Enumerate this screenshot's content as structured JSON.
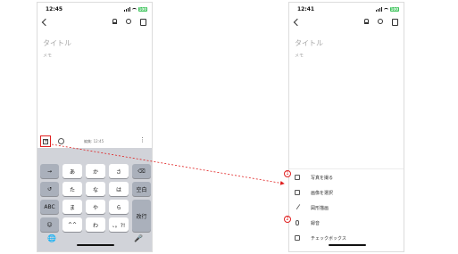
{
  "left_phone": {
    "status_time": "12:45",
    "battery": "100",
    "title_placeholder": "タイトル",
    "memo_placeholder": "メモ",
    "edited_text": "編集: 12:45",
    "keyboard": {
      "row1": [
        "→",
        "あ",
        "か",
        "さ",
        "⌫"
      ],
      "row2": [
        "↺",
        "た",
        "な",
        "は",
        "空白"
      ],
      "row3": [
        "ABC",
        "ま",
        "や",
        "ら",
        "改行"
      ],
      "row4": [
        "☺",
        "^^",
        "わ",
        "、。?!"
      ],
      "globe": "🌐",
      "mic": "🎤"
    }
  },
  "right_phone": {
    "status_time": "12:41",
    "battery": "100",
    "title_placeholder": "タイトル",
    "memo_placeholder": "メモ",
    "menu": [
      {
        "label": "写真を撮る",
        "icon": "camera-icon",
        "badge": "1"
      },
      {
        "label": "画像を選択",
        "icon": "image-icon",
        "badge": ""
      },
      {
        "label": "図形描画",
        "icon": "brush-icon",
        "badge": ""
      },
      {
        "label": "録音",
        "icon": "mic-icon",
        "badge": "2"
      },
      {
        "label": "チェックボックス",
        "icon": "checkbox-icon",
        "badge": ""
      }
    ]
  },
  "colors": {
    "annotation_red": "#e02020",
    "keyboard_bg": "#d1d3d9",
    "placeholder_gray": "#a8a8a8"
  }
}
